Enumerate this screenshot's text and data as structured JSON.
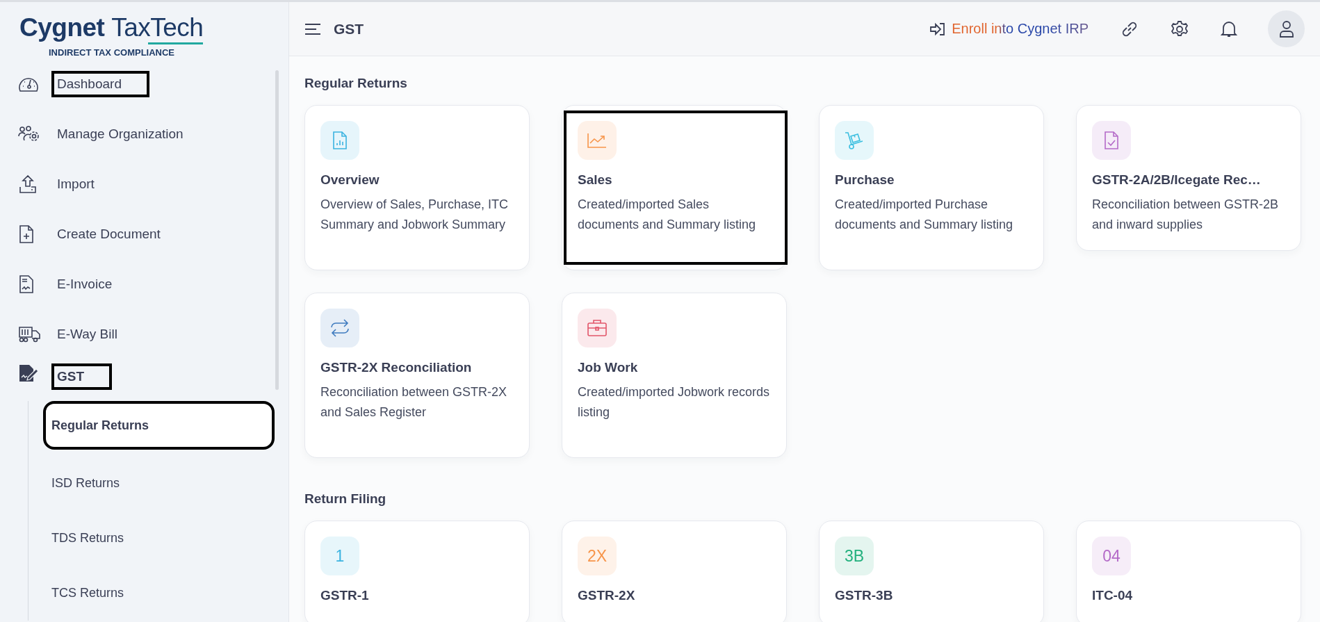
{
  "logo": {
    "brand_a": "Cygnet",
    "brand_b": "TaxTech",
    "tagline": "INDIRECT TAX COMPLIANCE"
  },
  "sidebar": {
    "items": [
      {
        "label": "Dashboard",
        "selected": false,
        "highlighted": true
      },
      {
        "label": "Manage Organization",
        "selected": false,
        "highlighted": false
      },
      {
        "label": "Import",
        "selected": false,
        "highlighted": false
      },
      {
        "label": "Create Document",
        "selected": false,
        "highlighted": false
      },
      {
        "label": "E-Invoice",
        "selected": false,
        "highlighted": false
      },
      {
        "label": "E-Way Bill",
        "selected": false,
        "highlighted": false
      },
      {
        "label": "GST",
        "selected": true,
        "highlighted": true,
        "expanded": true,
        "children": [
          {
            "label": "Regular Returns",
            "selected": true,
            "highlighted": true
          },
          {
            "label": "ISD Returns",
            "selected": false,
            "highlighted": false
          },
          {
            "label": "TDS Returns",
            "selected": false,
            "highlighted": false
          },
          {
            "label": "TCS Returns",
            "selected": false,
            "highlighted": false
          }
        ]
      }
    ]
  },
  "header": {
    "title": "GST",
    "enroll_link": "Enroll into Cygnet IRP"
  },
  "sections": [
    {
      "heading": "Regular Returns",
      "kind": "task",
      "cards": [
        {
          "title": "Overview",
          "description": "Overview of Sales, Purchase, ITC Summary and Jobwork Summary",
          "color": "#3bb3e0",
          "highlighted": false
        },
        {
          "title": "Sales",
          "description": "Created/imported Sales documents and Summary listing",
          "color": "#f7954a",
          "highlighted": true
        },
        {
          "title": "Purchase",
          "description": "Created/imported Purchase documents and Summary listing",
          "color": "#3cbfe0",
          "highlighted": false
        },
        {
          "title": "GSTR-2A/2B/Icegate Rec…",
          "description": "Reconciliation between GSTR-2B and inward supplies",
          "color": "#b46ac8",
          "highlighted": false
        },
        {
          "title": "GSTR-2X Reconciliation",
          "description": "Reconciliation between GSTR-2X and Sales Register",
          "color": "#3f7bbf",
          "highlighted": false
        },
        {
          "title": "Job Work",
          "description": "Created/imported Jobwork records listing",
          "color": "#e2566a",
          "highlighted": false
        }
      ]
    },
    {
      "heading": "Return Filing",
      "kind": "return",
      "cards": [
        {
          "badge": "1",
          "title": "GSTR-1",
          "color": "#3bb3e0"
        },
        {
          "badge": "2X",
          "title": "GSTR-2X",
          "color": "#f7954a"
        },
        {
          "badge": "3B",
          "title": "GSTR-3B",
          "color": "#22b07d"
        },
        {
          "badge": "04",
          "title": "ITC-04",
          "color": "#b46ac8"
        }
      ]
    }
  ]
}
